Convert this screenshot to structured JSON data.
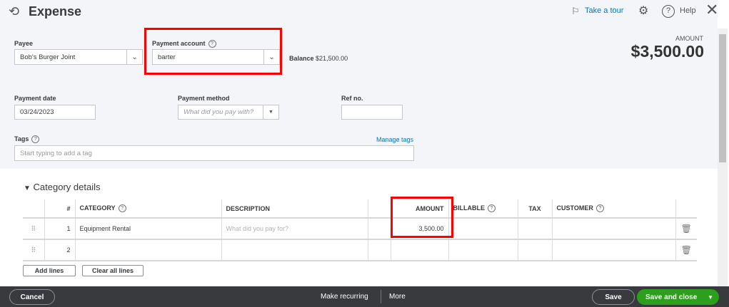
{
  "header": {
    "title": "Expense",
    "take_tour": "Take a tour",
    "help": "Help",
    "amount_label": "AMOUNT",
    "amount": "$3,500.00"
  },
  "form": {
    "payee_label": "Payee",
    "payee_value": "Bob's Burger Joint",
    "account_label": "Payment account",
    "account_value": "barter",
    "balance_label": "Balance",
    "balance_value": "$21,500.00",
    "date_label": "Payment date",
    "date_value": "03/24/2023",
    "method_label": "Payment method",
    "method_placeholder": "What did you pay with?",
    "ref_label": "Ref no.",
    "ref_value": "",
    "tags_label": "Tags",
    "manage_tags": "Manage tags",
    "tags_placeholder": "Start typing to add a tag"
  },
  "category": {
    "title": "Category details",
    "columns": [
      "#",
      "CATEGORY",
      "DESCRIPTION",
      "AMOUNT",
      "BILLABLE",
      "TAX",
      "CUSTOMER"
    ],
    "rows": [
      {
        "num": "1",
        "category": "Equipment Rental",
        "description_placeholder": "What did you pay for?",
        "amount": "3,500.00"
      },
      {
        "num": "2",
        "category": "",
        "description_placeholder": "",
        "amount": ""
      }
    ],
    "add_lines": "Add lines",
    "clear_lines": "Clear all lines"
  },
  "footer": {
    "cancel": "Cancel",
    "make_recurring": "Make recurring",
    "more": "More",
    "save": "Save",
    "save_close": "Save and close"
  },
  "colors": {
    "accent": "#2ca01c",
    "link": "#0077c5",
    "footer": "#393a3d",
    "highlight": "#ff0000"
  }
}
